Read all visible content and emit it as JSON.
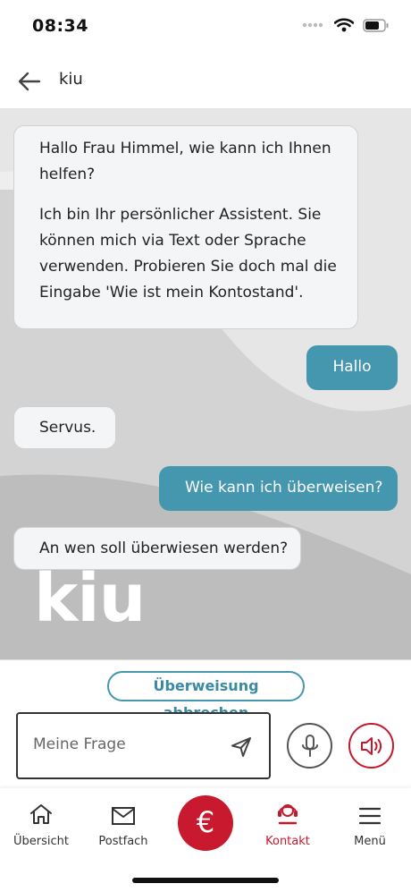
{
  "status": {
    "time": "08:34"
  },
  "header": {
    "title": "kiu",
    "back_icon": "arrow-left-icon"
  },
  "chat": {
    "watermark": "kiu",
    "messages": [
      {
        "from": "bot",
        "paragraphs": [
          "Hallo Frau Himmel, wie kann ich Ihnen helfen?",
          "Ich bin Ihr persönlicher Assistent. Sie können mich via Text oder Sprache verwenden. Probieren Sie doch mal die Eingabe 'Wie ist mein Kontostand'."
        ]
      },
      {
        "from": "user",
        "text": "Hallo"
      },
      {
        "from": "bot",
        "text": "Servus."
      },
      {
        "from": "user",
        "text": "Wie kann ich überweisen?"
      },
      {
        "from": "bot",
        "text": "An wen soll überwiesen werden?"
      }
    ]
  },
  "composer": {
    "cancel_label": "Überweisung abbrechen",
    "input_placeholder": "Meine Frage",
    "send_icon": "send-icon",
    "mic_icon": "microphone-icon",
    "speaker_icon": "speaker-icon"
  },
  "tabbar": {
    "items": [
      {
        "label": "Übersicht",
        "icon": "home-icon"
      },
      {
        "label": "Postfach",
        "icon": "mail-icon"
      },
      {
        "label": "",
        "icon": "euro-icon",
        "glyph": "€"
      },
      {
        "label": "Kontakt",
        "icon": "contact-icon",
        "active": true
      },
      {
        "label": "Menü",
        "icon": "menu-icon"
      }
    ]
  },
  "colors": {
    "accent_blue": "#4596af",
    "brand_red": "#c8192e",
    "bot_bubble": "#f4f5f6"
  }
}
